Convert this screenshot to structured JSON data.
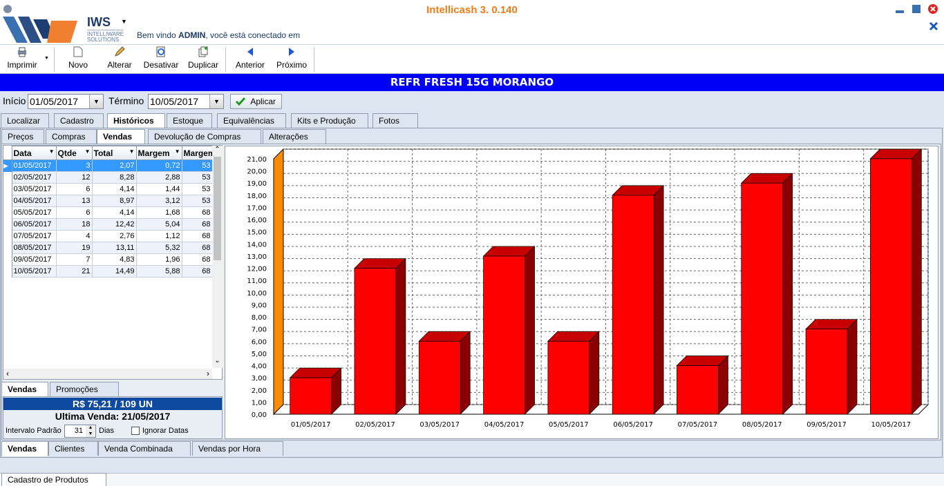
{
  "app": {
    "title": "Intellicash 3. 0.140",
    "logo_text": "IWS",
    "logo_sub1": "INTELLIWARE",
    "logo_sub2": "SOLUTIONS",
    "welcome_prefix": "Bem vindo ",
    "welcome_user": "ADMIN",
    "welcome_suffix": ", você está conectado em"
  },
  "toolbar": {
    "print": "Imprimir",
    "new": "Novo",
    "edit": "Alterar",
    "deactivate": "Desativar",
    "duplicate": "Duplicar",
    "previous": "Anterior",
    "next": "Próximo"
  },
  "product": {
    "name": "REFR FRESH 15G MORANGO"
  },
  "filter": {
    "start_label": "Início",
    "start_value": "01/05/2017",
    "end_label": "Término",
    "end_value": "10/05/2017",
    "apply_label": "Aplicar"
  },
  "main_tabs": [
    "Localizar",
    "Cadastro",
    "Históricos",
    "Estoque",
    "Equivalências",
    "Kits e Produção",
    "Fotos"
  ],
  "history_tabs": [
    "Preços",
    "Compras",
    "Vendas",
    "Devolução de Compras",
    "Alterações"
  ],
  "grid": {
    "headers": [
      "Data",
      "Qtde",
      "Total",
      "Margem",
      "Margem"
    ],
    "rows": [
      [
        "01/05/2017",
        "3",
        "2,07",
        "0,72",
        "53"
      ],
      [
        "02/05/2017",
        "12",
        "8,28",
        "2,88",
        "53"
      ],
      [
        "03/05/2017",
        "6",
        "4,14",
        "1,44",
        "53"
      ],
      [
        "04/05/2017",
        "13",
        "8,97",
        "3,12",
        "53"
      ],
      [
        "05/05/2017",
        "6",
        "4,14",
        "1,68",
        "68"
      ],
      [
        "06/05/2017",
        "18",
        "12,42",
        "5,04",
        "68"
      ],
      [
        "07/05/2017",
        "4",
        "2,76",
        "1,12",
        "68"
      ],
      [
        "08/05/2017",
        "19",
        "13,11",
        "5,32",
        "68"
      ],
      [
        "09/05/2017",
        "7",
        "4,83",
        "1,96",
        "68"
      ],
      [
        "10/05/2017",
        "21",
        "14,49",
        "5,88",
        "68"
      ]
    ]
  },
  "left_tabs": [
    "Vendas",
    "Promoções"
  ],
  "summary": {
    "total": "R$ 75,21 / 109 UN",
    "last_sale": "Ultima Venda: 21/05/2017",
    "interval_label": "Intervalo Padrão",
    "interval_value": "31",
    "days_label": "Dias",
    "ignore_dates_label": "Ignorar Datas"
  },
  "bottom_tabs": [
    "Vendas",
    "Clientes",
    "Venda Combinada",
    "Vendas por Hora"
  ],
  "status_tab": "Cadastro de Produtos",
  "colors": {
    "accent": "#f07c18",
    "product_bar": "#0000f8",
    "bar": "#ff0000",
    "bar_side": "#8b0000",
    "bar_top": "#c80000",
    "wall": "#ff8c00"
  },
  "chart_data": {
    "type": "bar",
    "categories": [
      "01/05/2017",
      "02/05/2017",
      "03/05/2017",
      "04/05/2017",
      "05/05/2017",
      "06/05/2017",
      "07/05/2017",
      "08/05/2017",
      "09/05/2017",
      "10/05/2017"
    ],
    "values": [
      3,
      12,
      6,
      13,
      6,
      18,
      4,
      19,
      7,
      21
    ],
    "ylim": [
      0,
      21
    ],
    "ytick_labels": [
      "0,00",
      "1,00",
      "2,00",
      "3,00",
      "4,00",
      "5,00",
      "6,00",
      "7,00",
      "8,00",
      "9,00",
      "10,00",
      "11,00",
      "12,00",
      "13,00",
      "14,00",
      "15,00",
      "16,00",
      "17,00",
      "18,00",
      "19,00",
      "20,00",
      "21,00"
    ],
    "grid": true,
    "three_d": true
  }
}
